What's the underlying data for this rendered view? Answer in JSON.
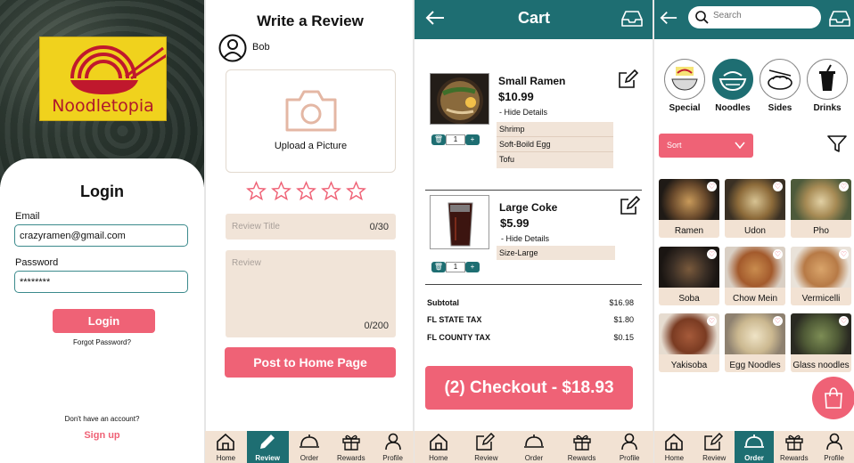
{
  "login": {
    "logo_text": "Noodletopia",
    "title": "Login",
    "email_label": "Email",
    "email_value": "crazyramen@gmail.com",
    "password_label": "Password",
    "password_value": "********",
    "login_button": "Login",
    "forgot": "Forgot Password?",
    "no_account": "Don't have an account?",
    "signup": "Sign up"
  },
  "review": {
    "title": "Write a Review",
    "user": "Bob",
    "upload_label": "Upload a Picture",
    "title_placeholder": "Review Title",
    "title_counter": "0/30",
    "body_placeholder": "Review",
    "body_counter": "0/200",
    "post_button": "Post to Home Page",
    "stars": 5
  },
  "cart": {
    "title": "Cart",
    "items": [
      {
        "name": "Small Ramen",
        "price": "$10.99",
        "toggle": "- Hide Details",
        "qty": "1",
        "details": [
          "Shrimp",
          "Soft-Boild Egg",
          "Tofu"
        ]
      },
      {
        "name": "Large Coke",
        "price": "$5.99",
        "toggle": "- Hide Details",
        "qty": "1",
        "details": [
          "Size-Large"
        ]
      }
    ],
    "totals": [
      {
        "label": "Subtotal",
        "value": "$16.98"
      },
      {
        "label": "FL STATE TAX",
        "value": "$1.80"
      },
      {
        "label": "FL COUNTY TAX",
        "value": "$0.15"
      }
    ],
    "checkout": "(2) Checkout - $18.93"
  },
  "order": {
    "search_placeholder": "Search",
    "categories": [
      "Special",
      "Noodles",
      "Sides",
      "Drinks"
    ],
    "sort_label": "Sort",
    "tiles": [
      "Ramen",
      "Udon",
      "Pho",
      "Soba",
      "Chow Mein",
      "Vermicelli",
      "Yakisoba",
      "Egg Noodles",
      "Glass noodles"
    ]
  },
  "nav": {
    "a": [
      "Home",
      "Review",
      "Order",
      "Rewards",
      "Profile"
    ],
    "b": [
      "Home",
      "Review",
      "Order",
      "Rewards",
      "Profile"
    ],
    "c": [
      "Home",
      "Review",
      "Order",
      "Rewards",
      "Profile"
    ]
  },
  "colors": {
    "teal": "#1e6e72",
    "pink": "#ef6276",
    "beige": "#f1e4d8",
    "yellow": "#f0d21d"
  }
}
